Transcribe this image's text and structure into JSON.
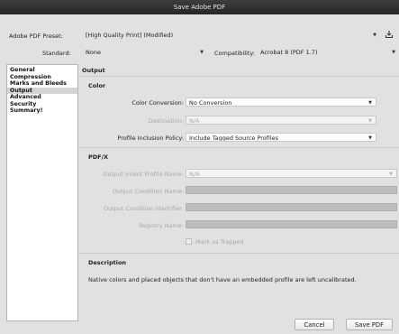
{
  "window": {
    "title": "Save Adobe PDF"
  },
  "preset": {
    "label": "Adobe PDF Preset:",
    "value": "[High Quality Print] (Modified)"
  },
  "standard": {
    "label": "Standard:",
    "value": "None"
  },
  "compatibility": {
    "label": "Compatibility:",
    "value": "Acrobat 8 (PDF 1.7)"
  },
  "sidebar": {
    "items": [
      {
        "label": "General"
      },
      {
        "label": "Compression"
      },
      {
        "label": "Marks and Bleeds"
      },
      {
        "label": "Output"
      },
      {
        "label": "Advanced"
      },
      {
        "label": "Security"
      },
      {
        "label": "Summary!"
      }
    ],
    "selected_index": 3
  },
  "panel": {
    "title": "Output",
    "color": {
      "heading": "Color",
      "conversion_label": "Color Conversion:",
      "conversion_value": "No Conversion",
      "destination_label": "Destination:",
      "destination_value": "N/A",
      "profile_label": "Profile Inclusion Policy:",
      "profile_value": "Include Tagged Source Profiles"
    },
    "pdfx": {
      "heading": "PDF/X",
      "intent_label": "Output Intent Profile Name:",
      "intent_value": "N/A",
      "condition_name_label": "Output Condition Name:",
      "condition_id_label": "Output Condition Identifier:",
      "registry_label": "Registry Name:",
      "trapped_label": "Mark as Trapped"
    },
    "description": {
      "heading": "Description",
      "text": "Native colors and placed objects that don't have an embedded profile are left uncalibrated."
    }
  },
  "buttons": {
    "cancel": "Cancel",
    "save": "Save PDF"
  },
  "colors": {
    "titlebar": "#2e2e2e",
    "dialog": "#e1e1e1",
    "selected_row": "#d4d4d4"
  }
}
